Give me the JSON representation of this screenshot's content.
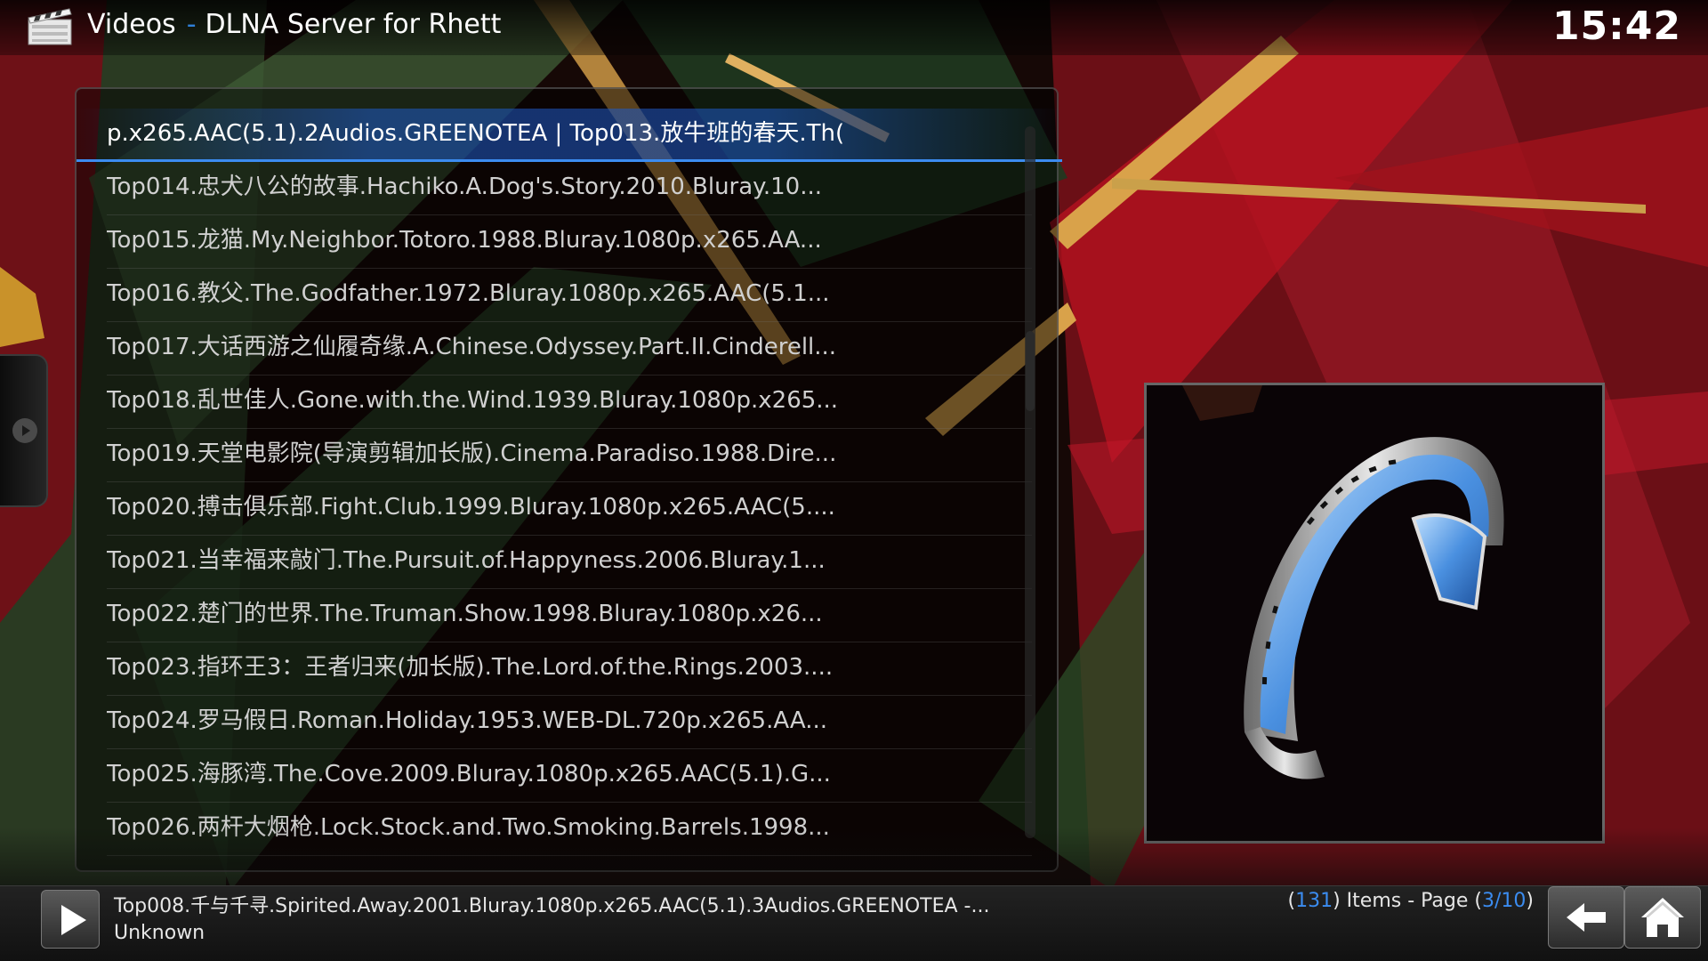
{
  "header": {
    "section": "Videos",
    "separator": "-",
    "source": "DLNA Server for Rhett",
    "clock": "15:42",
    "icon": "clapperboard-icon"
  },
  "list": {
    "items": [
      ")p.x265.AAC(5.1).2Audios.GREENOTEA | Top013.放牛班的春天.Th",
      "Top014.忠犬八公的故事.Hachiko.A.Dog's.Story.2010.Bluray.10...",
      "Top015.龙猫.My.Neighbor.Totoro.1988.Bluray.1080p.x265.AA...",
      "Top016.教父.The.Godfather.1972.Bluray.1080p.x265.AAC(5.1...",
      "Top017.大话西游之仙履奇缘.A.Chinese.Odyssey.Part.II.Cinderell...",
      "Top018.乱世佳人.Gone.with.the.Wind.1939.Bluray.1080p.x265...",
      "Top019.天堂电影院(导演剪辑加长版).Cinema.Paradiso.1988.Dire...",
      "Top020.搏击俱乐部.Fight.Club.1999.Bluray.1080p.x265.AAC(5....",
      "Top021.当幸福来敲门.The.Pursuit.of.Happyness.2006.Bluray.1...",
      "Top022.楚门的世界.The.Truman.Show.1998.Bluray.1080p.x26...",
      "Top023.指环王3：王者归来(加长版).The.Lord.of.the.Rings.2003....",
      "Top024.罗马假日.Roman.Holiday.1953.WEB-DL.720p.x265.AA...",
      "Top025.海豚湾.The.Cove.2009.Bluray.1080p.x265.AAC(5.1).G...",
      "Top026.两杆大烟枪.Lock.Stock.and.Two.Smoking.Barrels.1998..."
    ],
    "selected_index": 0
  },
  "thumbnail": {
    "icon": "film-reel-icon"
  },
  "footer": {
    "now_title": "Top008.千与千寻.Spirited.Away.2001.Bluray.1080p.x265.AAC(5.1).3Audios.GREENOTEA -...",
    "now_sub": "Unknown",
    "items_prefix": "(",
    "item_count": "131",
    "items_mid": ") Items - Page (",
    "page_current": "3",
    "page_sep": "/",
    "page_total": "10",
    "items_suffix": ")",
    "play_icon": "play-icon",
    "back_icon": "back-arrow-icon",
    "home_icon": "home-icon"
  },
  "colors": {
    "accent": "#3b8cf0",
    "text": "#d0d0d0",
    "background_red": "#7a1218",
    "background_green": "#2f4a2a"
  }
}
